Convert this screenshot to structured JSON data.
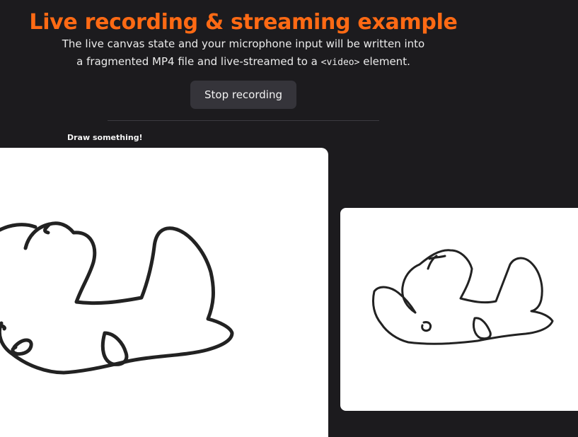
{
  "header": {
    "title": "Live recording & streaming example",
    "description_line1": "The live canvas state and your microphone input will be written into",
    "description_line2_prefix": "a fragmented MP4 file and live-streamed to a ",
    "description_line2_code": "<video>",
    "description_line2_suffix": " element."
  },
  "controls": {
    "stop_button_label": "Stop recording"
  },
  "canvas_section": {
    "label": "Draw something!"
  },
  "colors": {
    "title_accent": "#ff6a14",
    "background": "#1c1b1e",
    "button_bg": "#35343a",
    "stroke": "#222222"
  }
}
